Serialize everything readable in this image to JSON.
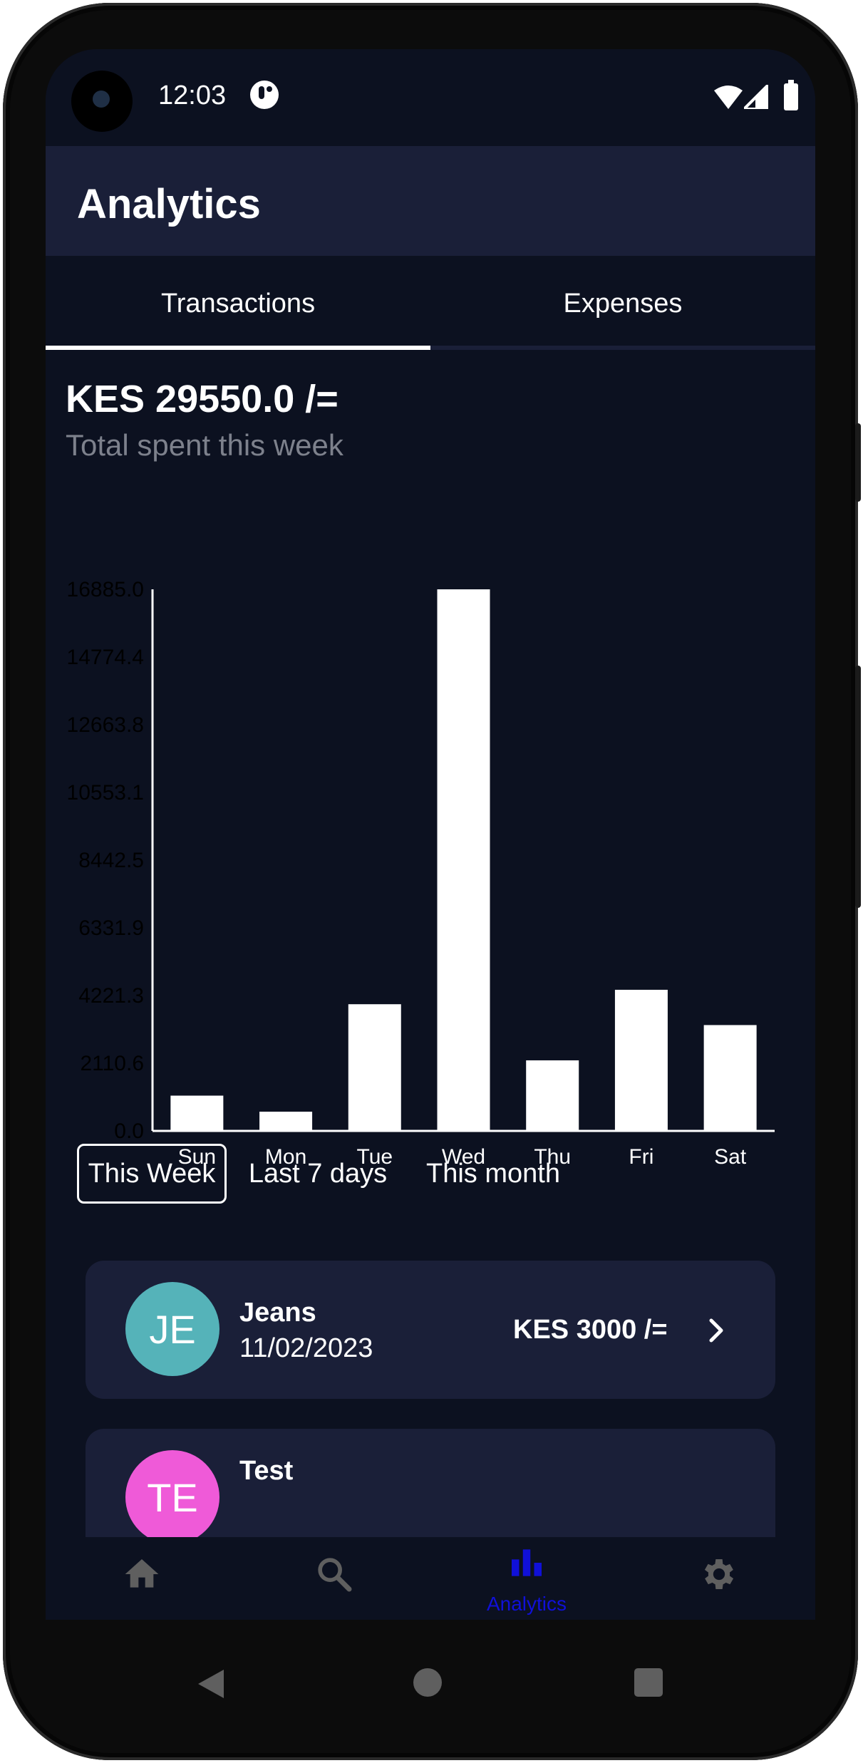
{
  "status_bar": {
    "time": "12:03"
  },
  "app_bar": {
    "title": "Analytics"
  },
  "tabs": [
    {
      "label": "Transactions",
      "selected": true
    },
    {
      "label": "Expenses",
      "selected": false
    }
  ],
  "summary": {
    "total": "KES 29550.0 /=",
    "caption": "Total spent this week"
  },
  "chart_data": {
    "type": "bar",
    "categories": [
      "Sun",
      "Mon",
      "Tue",
      "Wed",
      "Thu",
      "Fri",
      "Sat"
    ],
    "values": [
      1100,
      600,
      3950,
      16885,
      2200,
      4400,
      3300
    ],
    "yticks": [
      "0.0",
      "2110.6",
      "4221.3",
      "6331.9",
      "8442.5",
      "10553.1",
      "12663.8",
      "14774.4",
      "16885.0"
    ],
    "ylim": [
      0,
      16885
    ],
    "bar_color": "#ffffff",
    "axis_color": "#ffffff",
    "ytick_color": "#000000",
    "grid": false
  },
  "filters": [
    {
      "label": "This Week",
      "selected": true
    },
    {
      "label": "Last 7 days",
      "selected": false
    },
    {
      "label": "This month",
      "selected": false
    }
  ],
  "transactions": [
    {
      "initials": "JE",
      "name": "Jeans",
      "date": "11/02/2023",
      "amount": "KES 3000 /=",
      "avatar_color": "#55b3b9"
    },
    {
      "initials": "TE",
      "name": "Test",
      "date": "",
      "amount": "",
      "avatar_color": "#ef5ad8"
    }
  ],
  "bottom_nav": [
    {
      "icon": "home-icon",
      "label": ""
    },
    {
      "icon": "search-icon",
      "label": ""
    },
    {
      "icon": "analytics-icon",
      "label": "Analytics",
      "selected": true
    },
    {
      "icon": "settings-icon",
      "label": ""
    }
  ],
  "colors": {
    "background": "#0c1120",
    "surface": "#1a1f38",
    "accent": "#1010d8",
    "inactive_icon": "#5f5f5f"
  }
}
